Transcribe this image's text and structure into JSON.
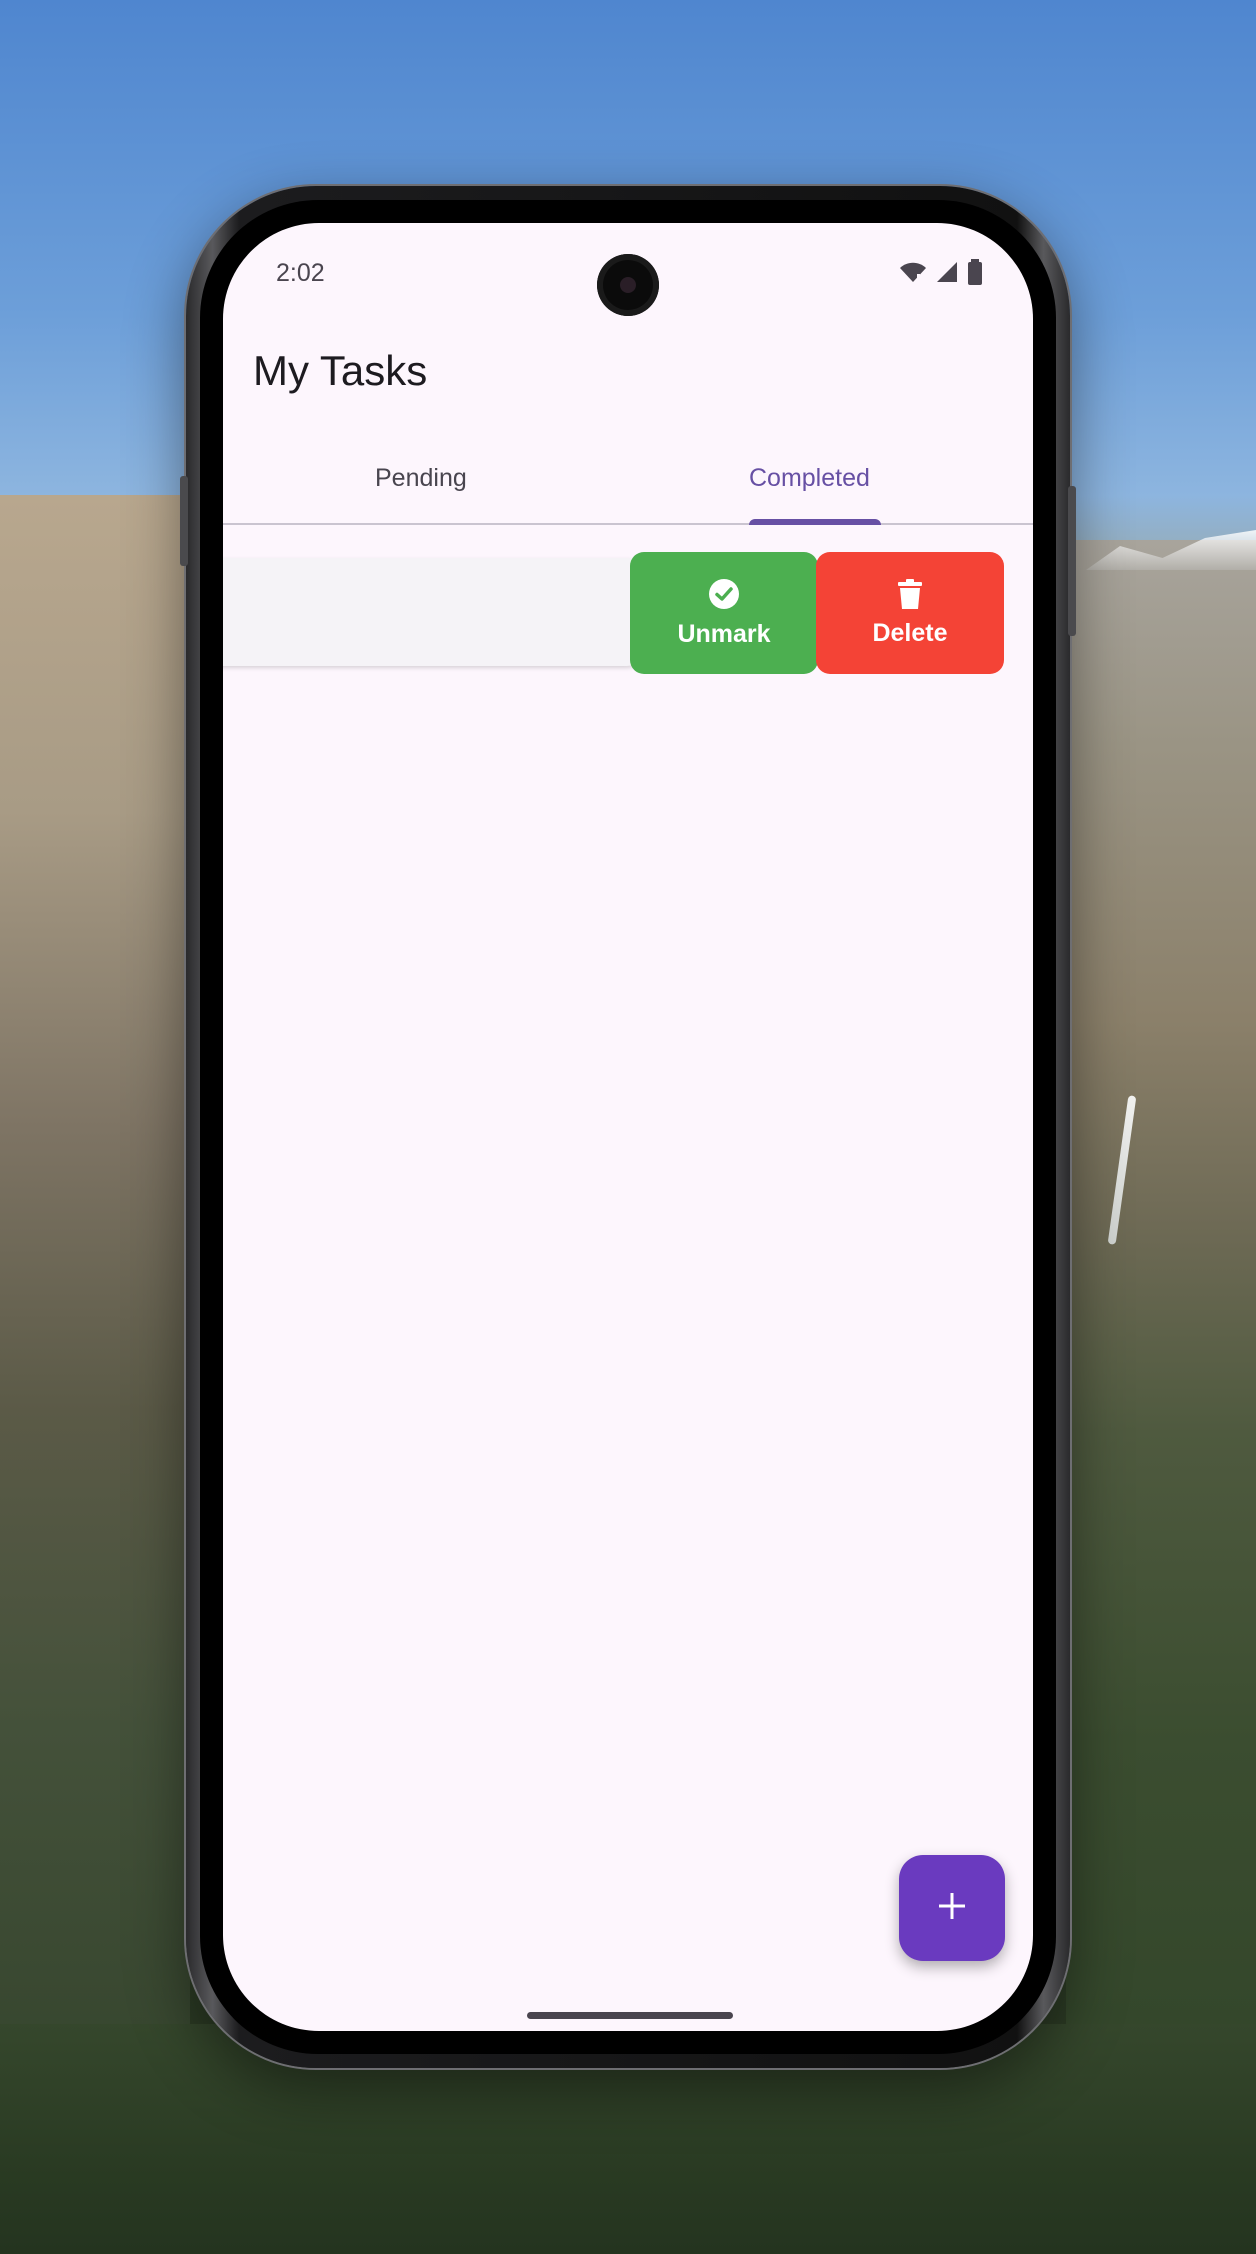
{
  "status_bar": {
    "time": "2:02"
  },
  "app_bar": {
    "title": "My Tasks"
  },
  "tabs": [
    {
      "label": "Pending",
      "selected": false
    },
    {
      "label": "Completed",
      "selected": true
    }
  ],
  "swipe_actions": {
    "unmark_label": "Unmark",
    "unmark_icon": "check-circle-icon",
    "delete_label": "Delete",
    "delete_icon": "trash-icon"
  },
  "fab": {
    "icon": "plus-icon"
  },
  "colors": {
    "primary": "#6750a4",
    "unmark": "#4caf50",
    "delete": "#f44336",
    "fab": "#6a3abf",
    "surface": "#fdf6fd"
  }
}
